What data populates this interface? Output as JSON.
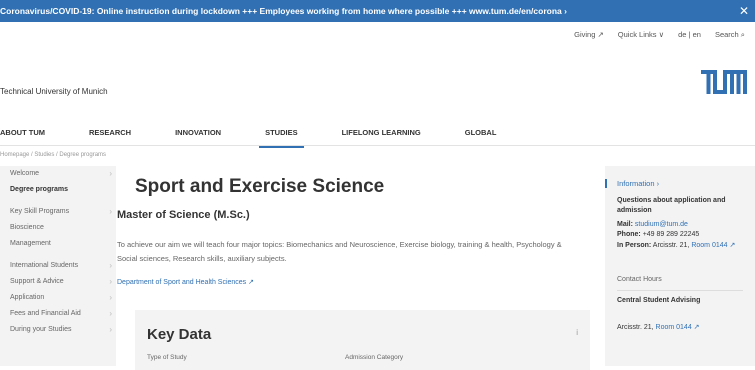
{
  "banner": {
    "text": "Coronavirus/COVID-19: Online instruction during lockdown +++ Employees working from home where possible +++ www.tum.de/en/corona ›",
    "close": "✕"
  },
  "utility": {
    "giving": "Giving ↗",
    "quicklinks": "Quick Links ∨",
    "lang": "de | en",
    "search": "Search ⌕"
  },
  "header": {
    "university_name": "Technical University of Munich",
    "logo_text": "TUM",
    "brand_color": "#3070b3"
  },
  "nav": {
    "items": [
      "ABOUT TUM",
      "RESEARCH",
      "INNOVATION",
      "STUDIES",
      "LIFELONG LEARNING",
      "GLOBAL"
    ],
    "active": "STUDIES"
  },
  "breadcrumb": "Homepage / Studies / Degree programs",
  "sidebar": {
    "items": [
      {
        "label": "Welcome",
        "chevron": "›"
      },
      {
        "label": "Degree programs",
        "chevron": ""
      },
      {
        "label": "Key Skill Programs",
        "chevron": "›"
      },
      {
        "label": "Bioscience",
        "chevron": ""
      },
      {
        "label": "Management",
        "chevron": ""
      },
      {
        "label": "International Students",
        "chevron": "›"
      },
      {
        "label": "Support & Advice",
        "chevron": "›"
      },
      {
        "label": "Application",
        "chevron": "›"
      },
      {
        "label": "Fees and Financial Aid",
        "chevron": "›"
      },
      {
        "label": "During your Studies",
        "chevron": "›"
      }
    ]
  },
  "main": {
    "title": "Sport and Exercise Science",
    "degree": "Master of Science (M.Sc.)",
    "description": "To achieve our aim we will teach four major topics: Biomechanics and Neuroscience, Exercise biology, training & health, Psychology & Social sciences, Research skills, auxiliary subjects.",
    "department_link": "Department of Sport and Health Sciences ↗"
  },
  "key_data": {
    "title": "Key Data",
    "info_icon": "i",
    "label_type": "Type of Study",
    "label_admission": "Admission Category"
  },
  "info_panel": {
    "title": "Information ›",
    "question": "Questions about application and admission",
    "mail_label": "Mail:",
    "mail_value": "studium@tum.de",
    "phone_label": "Phone:",
    "phone_value": "+49 89 289 22245",
    "person_label": "In Person:",
    "person_value": "Arcisstr. 21,",
    "person_room": "Room 0144 ↗",
    "contact_hours": "Contact Hours",
    "central_title": "Central Student Advising",
    "central_address": "Arcisstr. 21,",
    "central_room": "Room 0144 ↗"
  }
}
